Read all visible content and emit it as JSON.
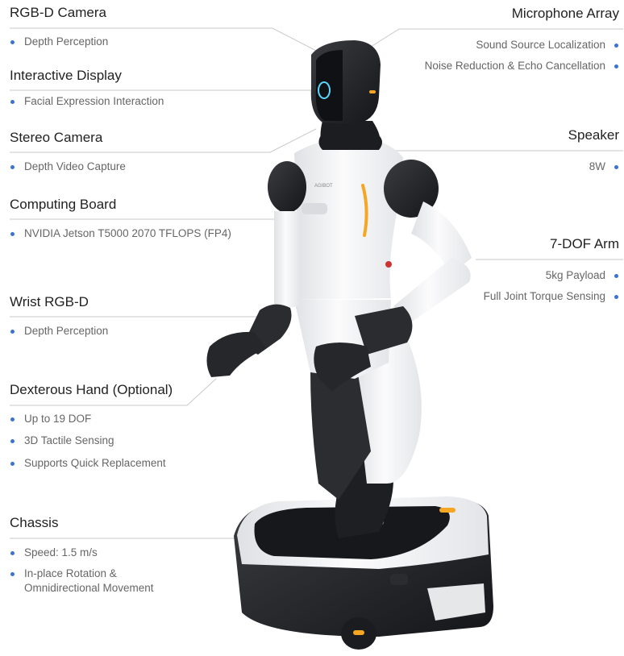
{
  "colors": {
    "bullet": "#3a73d4",
    "accent_light": "#f5a623"
  },
  "features": {
    "rgbd_camera": {
      "title": "RGB-D Camera",
      "items": [
        "Depth Perception"
      ]
    },
    "interactive_display": {
      "title": "Interactive Display",
      "items": [
        "Facial Expression Interaction"
      ]
    },
    "stereo_camera": {
      "title": "Stereo Camera",
      "items": [
        "Depth Video Capture"
      ]
    },
    "computing_board": {
      "title": "Computing Board",
      "items": [
        "NVIDIA Jetson T5000 2070 TFLOPS (FP4)"
      ]
    },
    "wrist_rgbd": {
      "title": "Wrist RGB-D",
      "items": [
        "Depth Perception"
      ]
    },
    "dexterous_hand": {
      "title": "Dexterous Hand (Optional)",
      "items": [
        "Up to 19 DOF",
        "3D Tactile Sensing",
        "Supports Quick Replacement"
      ]
    },
    "chassis": {
      "title": "Chassis",
      "items": [
        "Speed: 1.5 m/s",
        "In-place Rotation & Omnidirectional Movement"
      ]
    },
    "microphone_array": {
      "title": "Microphone Array",
      "items": [
        "Sound Source Localization",
        "Noise Reduction & Echo Cancellation"
      ]
    },
    "speaker": {
      "title": "Speaker",
      "items": [
        "8W"
      ]
    },
    "arm": {
      "title": "7-DOF Arm",
      "items": [
        "5kg Payload",
        "Full Joint Torque Sensing"
      ]
    }
  },
  "robot": {
    "brand_mark": "AGIBOT"
  }
}
